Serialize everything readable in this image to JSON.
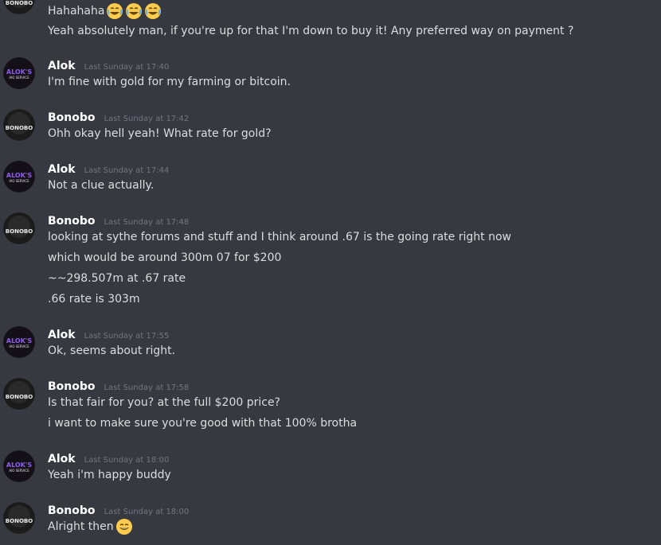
{
  "avatars": {
    "bonobo_text": "BONOBO",
    "alok_text_top": "ALOK'S",
    "alok_text_bottom": "AIO SERVICE"
  },
  "messages": [
    {
      "author": "",
      "timestamp": "",
      "avatar": "bonobo",
      "lines": [
        {
          "text": "Hahahaha",
          "emoji": [
            "joy-emoji",
            "joy-emoji",
            "joy-emoji"
          ]
        },
        {
          "text": "Yeah absolutely man, if you're up for that I'm down to buy it! Any preferred way on payment ?"
        }
      ]
    },
    {
      "author": "Alok",
      "timestamp": "Last Sunday at 17:40",
      "avatar": "alok",
      "lines": [
        {
          "text": "I'm fine with gold for my farming or bitcoin."
        }
      ]
    },
    {
      "author": "Bonobo",
      "timestamp": "Last Sunday at 17:42",
      "avatar": "bonobo",
      "lines": [
        {
          "text": "Ohh okay hell yeah! What rate for gold?"
        }
      ]
    },
    {
      "author": "Alok",
      "timestamp": "Last Sunday at 17:44",
      "avatar": "alok",
      "lines": [
        {
          "text": "Not a clue actually."
        }
      ]
    },
    {
      "author": "Bonobo",
      "timestamp": "Last Sunday at 17:48",
      "avatar": "bonobo",
      "lines": [
        {
          "text": "looking at sythe forums and stuff and I think around .67 is the going rate right now"
        },
        {
          "text": "which would be around 300m 07 for $200"
        },
        {
          "text": "~~298.507m at .67 rate"
        },
        {
          "text": ".66 rate is 303m"
        }
      ]
    },
    {
      "author": "Alok",
      "timestamp": "Last Sunday at 17:55",
      "avatar": "alok",
      "lines": [
        {
          "text": "Ok, seems about right."
        }
      ]
    },
    {
      "author": "Bonobo",
      "timestamp": "Last Sunday at 17:58",
      "avatar": "bonobo",
      "lines": [
        {
          "text": "Is that fair for you? at the full $200 price?"
        },
        {
          "text": "i want to make sure you're good with that 100% brotha"
        }
      ]
    },
    {
      "author": "Alok",
      "timestamp": "Last Sunday at 18:00",
      "avatar": "alok",
      "lines": [
        {
          "text": "Yeah i'm happy buddy"
        }
      ]
    },
    {
      "author": "Bonobo",
      "timestamp": "Last Sunday at 18:00",
      "avatar": "bonobo",
      "lines": [
        {
          "text": "Alright then",
          "emoji": [
            "grin-emoji"
          ]
        }
      ]
    }
  ]
}
